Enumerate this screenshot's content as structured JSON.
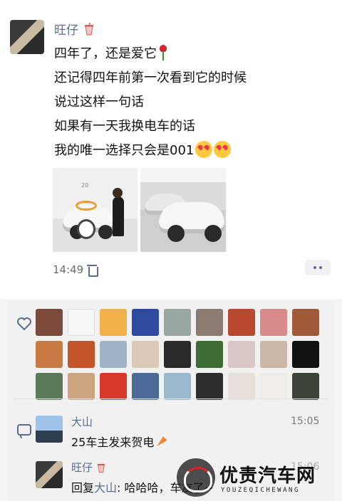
{
  "post": {
    "author": "旺仔",
    "lines": [
      "四年了，还是爱它",
      "还记得四年前第一次看到它的时候",
      "说过这样一句话",
      "如果有一天我换电车的话",
      "我的唯一选择只会是001"
    ],
    "photo1_sign": "20",
    "timestamp": "14:49"
  },
  "likes": {
    "avatar_colors": [
      "#7a4a3a",
      "#f7f7f7",
      "#f2b24a",
      "#2d4aa0",
      "#9aa6a0",
      "#8a7a70",
      "#b8482e",
      "#d98a8a",
      "#a05a3a",
      "#c97a42",
      "#c2562a",
      "#9fb3c6",
      "#d9c9b6",
      "#2a2a2a",
      "#3e6b32",
      "#d8c7c2",
      "#cdb8a8",
      "#111111",
      "#5a7a58",
      "#caa47c",
      "#d83a2a",
      "#4a6a9a",
      "#9ab8cc",
      "#2e2e2e",
      "#e6e0d8",
      "#f0ece8",
      "#3c4438"
    ]
  },
  "comments": [
    {
      "name": "大山",
      "time": "15:05",
      "text": "25车主发来贺电"
    },
    {
      "name": "旺仔",
      "time": "15:06",
      "reply_prefix": "回复",
      "reply_to": "大山",
      "text": ": 哈哈哈，车友了~"
    }
  ],
  "watermark": {
    "title": "优责汽车网",
    "subtitle": "YOUZEQICHEWANG"
  },
  "colors": {
    "link_blue": "#5b6b92",
    "background": "#f5f5f5",
    "panel": "#f1f1f1"
  }
}
